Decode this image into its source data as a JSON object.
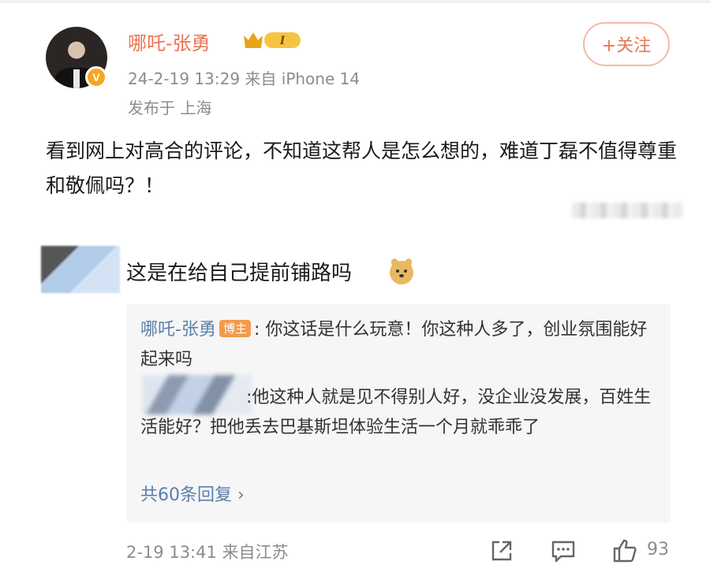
{
  "post": {
    "username": "哪吒-张勇",
    "vip_level": "I",
    "verified_mark": "V",
    "meta": "24-2-19 13:29  来自 iPhone 14",
    "location": "发布于 上海",
    "follow_label": "+关注",
    "content": "看到网上对高合的评论，不知道这帮人是怎么想的，难道丁磊不值得尊重和敬佩吗？！"
  },
  "comment": {
    "text": "这是在给自己提前铺路吗",
    "emoji": "doge-icon",
    "replies": [
      {
        "name": "哪吒-张勇",
        "badge": "博主",
        "text": ": 你这话是什么玩意！你这种人多了，创业氛围能好起来吗"
      },
      {
        "text": ":他这种人就是见不得别人好，没企业没发展，百姓生活能好？把他丢去巴基斯坦体验生活一个月就乖乖了"
      }
    ],
    "more_replies": "共60条回复 ›",
    "time": "2-19 13:41  来自江苏",
    "like_count": "93"
  },
  "colors": {
    "accent": "#eb7350",
    "link": "#5b7fad",
    "muted": "#8c8c8c",
    "reply_bg": "#f6f6f6"
  }
}
